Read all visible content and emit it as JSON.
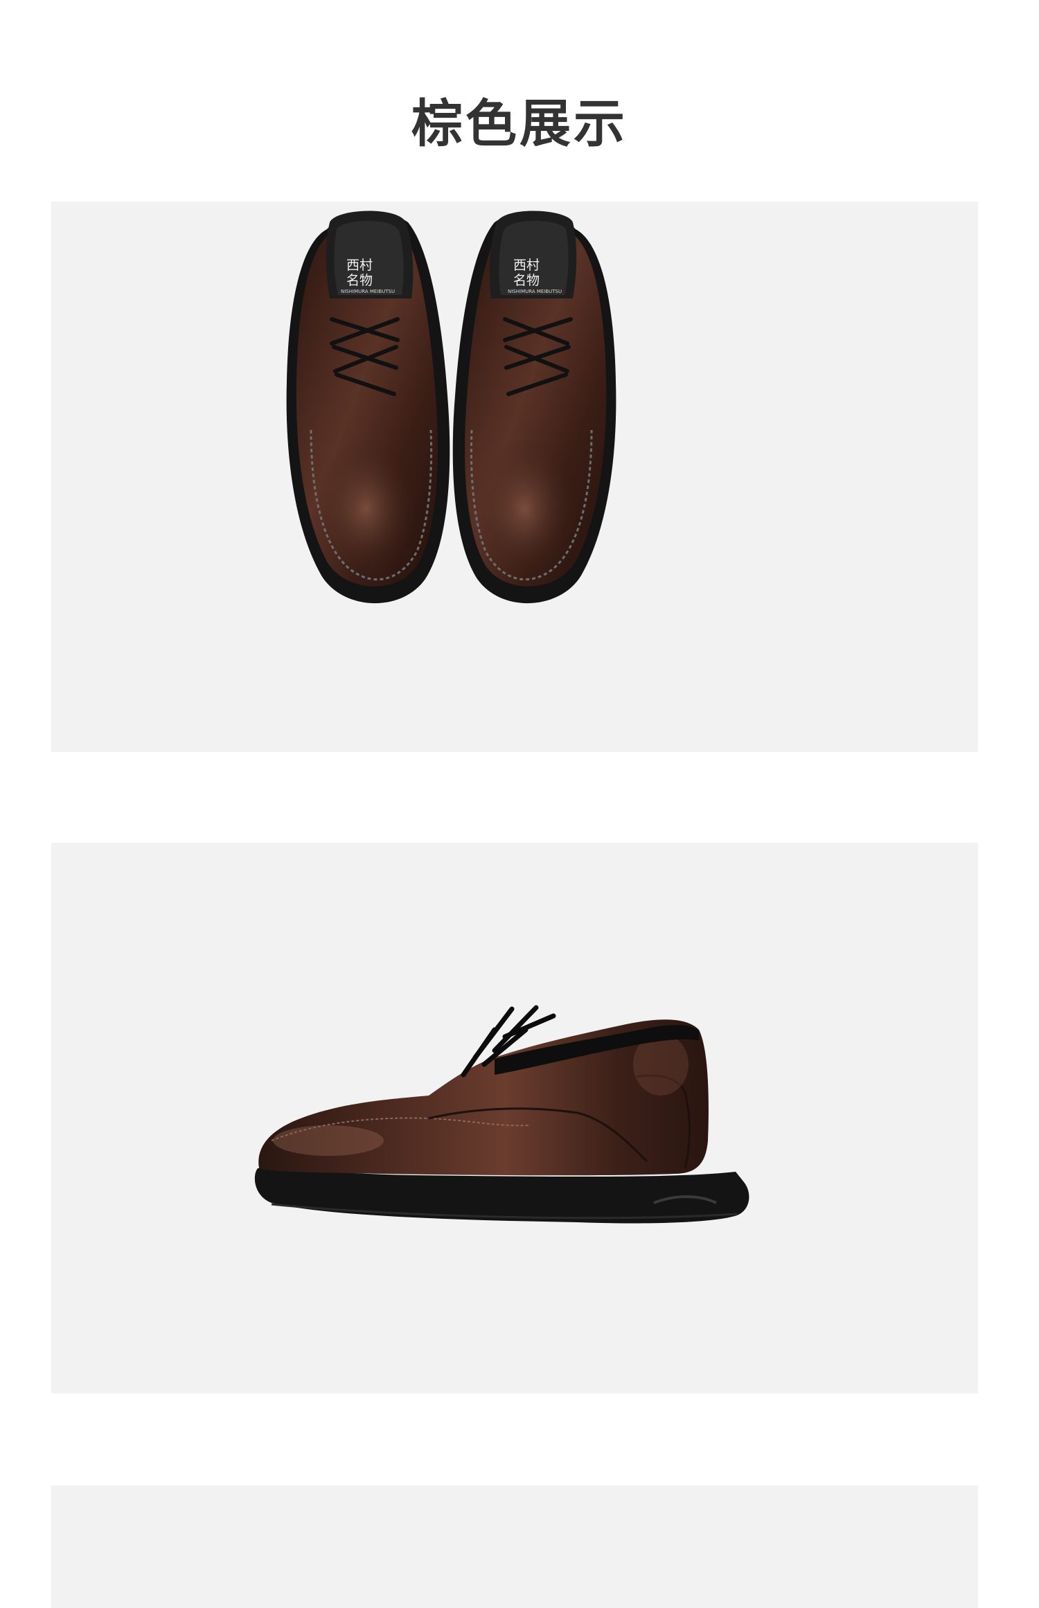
{
  "page": {
    "title": "棕色展示"
  },
  "product": {
    "insole_logo_line1": "西村",
    "insole_logo_line2": "名物",
    "insole_logo_sub": "NISHIMURA MEIBUTSU"
  },
  "colors": {
    "background": "#ffffff",
    "panel": "#f2f2f2",
    "title": "#333333",
    "leather": "#3a1f18",
    "sole": "#1a1a1a"
  }
}
